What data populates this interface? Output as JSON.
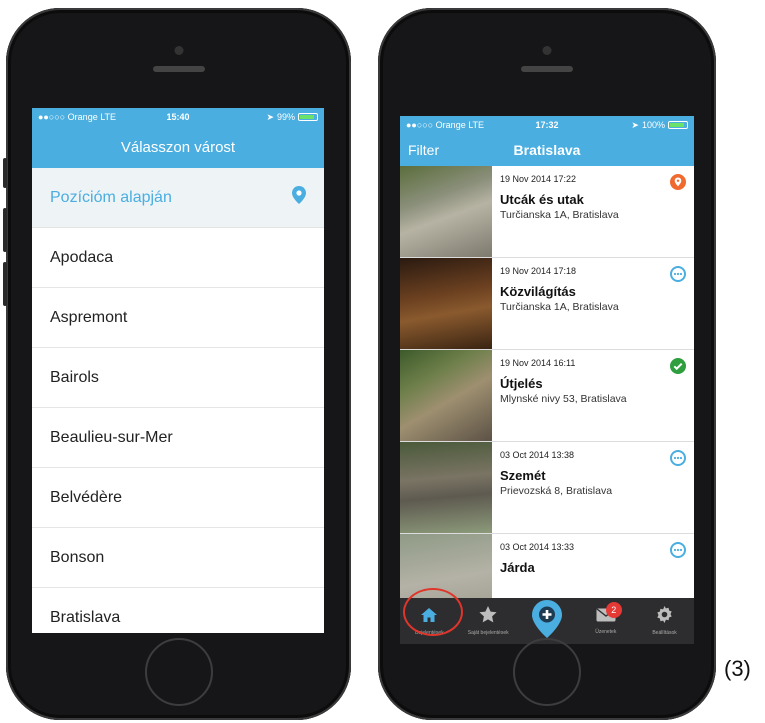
{
  "phone1": {
    "status": {
      "carrier": "●●○○○ Orange  LTE",
      "time": "15:40",
      "battery": "99%"
    },
    "nav_title": "Válasszon várost",
    "position_label": "Pozícióm alapján",
    "cities": [
      "Apodaca",
      "Aspremont",
      "Bairols",
      "Beaulieu-sur-Mer",
      "Belvédère",
      "Bonson",
      "Bratislava"
    ]
  },
  "phone2": {
    "status": {
      "carrier": "●●○○○ Orange  LTE",
      "time": "17:32",
      "battery": "100%"
    },
    "filter_label": "Filter",
    "nav_title": "Bratislava",
    "reports": [
      {
        "date": "19 Nov 2014 17:22",
        "category": "Utcák és utak",
        "address": "Turčianska 1A, Bratislava",
        "status": "new",
        "status_color": "#f0692e"
      },
      {
        "date": "19 Nov 2014 17:18",
        "category": "Közvilágítás",
        "address": "Turčianska 1A, Bratislava",
        "status": "pending",
        "status_color": "#4aaee0"
      },
      {
        "date": "19 Nov 2014 16:11",
        "category": "Útjelés",
        "address": "Mlynské nivy 53, Bratislava",
        "status": "resolved",
        "status_color": "#2e9e3e"
      },
      {
        "date": "03 Oct 2014 13:38",
        "category": "Szemét",
        "address": "Prievozská 8, Bratislava",
        "status": "pending",
        "status_color": "#4aaee0"
      },
      {
        "date": "03 Oct 2014 13:33",
        "category": "Járda",
        "address": "",
        "status": "pending",
        "status_color": "#4aaee0"
      }
    ],
    "tabs": [
      {
        "icon": "home-icon",
        "label": "Bejelentések"
      },
      {
        "icon": "star-icon",
        "label": "Saját bejelentések"
      },
      {
        "icon": "add-report-icon",
        "label": ""
      },
      {
        "icon": "messages-icon",
        "label": "Üzenetek",
        "badge": "2"
      },
      {
        "icon": "settings-icon",
        "label": "Beállítások"
      }
    ]
  },
  "figure_label": "(3)",
  "colors": {
    "accent": "#4aaee0",
    "tabbar": "#2d2d2f",
    "highlight": "#e0352b"
  }
}
